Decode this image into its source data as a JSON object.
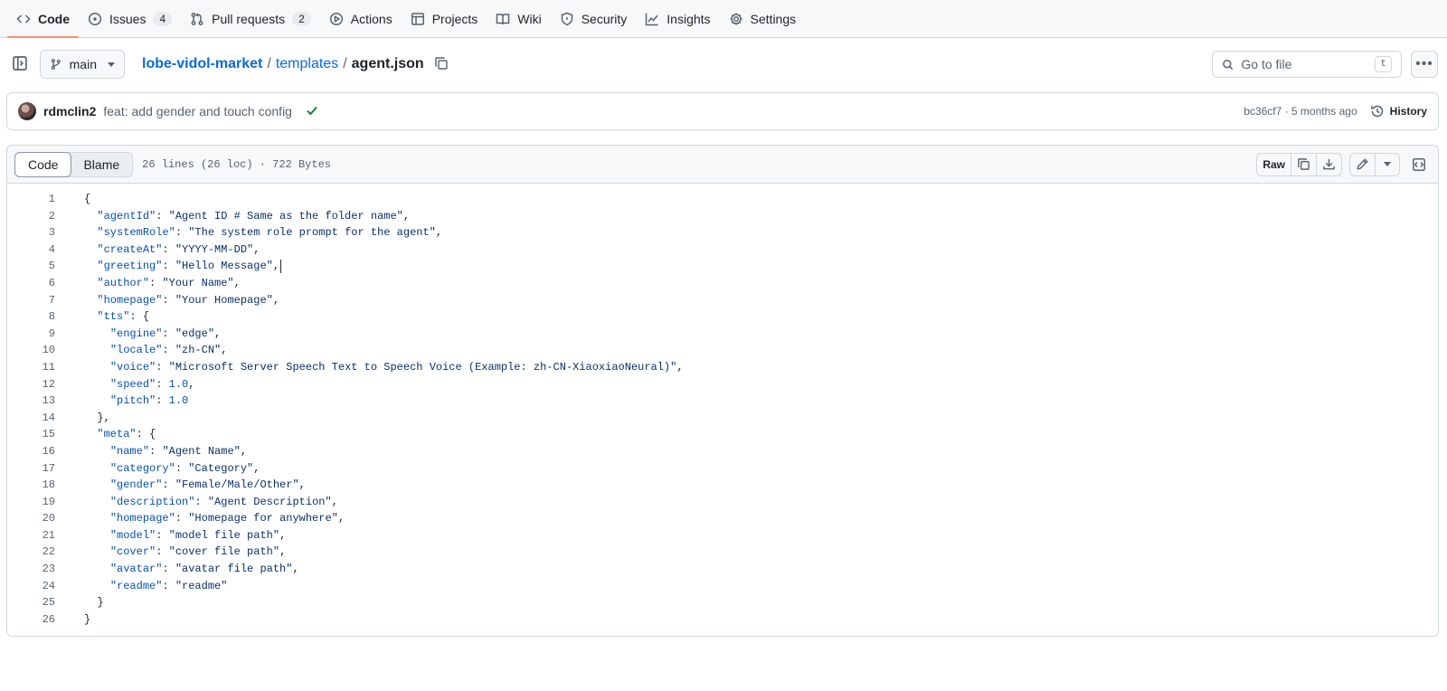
{
  "nav": {
    "tabs": [
      {
        "label": "Code",
        "icon": "code-icon",
        "active": true
      },
      {
        "label": "Issues",
        "icon": "issue-icon",
        "count": "4"
      },
      {
        "label": "Pull requests",
        "icon": "pull-request-icon",
        "count": "2"
      },
      {
        "label": "Actions",
        "icon": "play-icon"
      },
      {
        "label": "Projects",
        "icon": "table-icon"
      },
      {
        "label": "Wiki",
        "icon": "book-icon"
      },
      {
        "label": "Security",
        "icon": "shield-icon"
      },
      {
        "label": "Insights",
        "icon": "graph-icon"
      },
      {
        "label": "Settings",
        "icon": "gear-icon"
      }
    ]
  },
  "branch": {
    "name": "main"
  },
  "breadcrumb": {
    "repo": "lobe-vidol-market",
    "sep": "/",
    "folder": "templates",
    "file": "agent.json"
  },
  "goto": {
    "placeholder": "Go to file",
    "shortcut": "t"
  },
  "commit": {
    "author": "rdmclin2",
    "message": "feat: add gender and touch config",
    "meta": "bc36cf7 · 5 months ago",
    "history_label": "History"
  },
  "file": {
    "view_code": "Code",
    "view_blame": "Blame",
    "info": "26 lines (26 loc) · 722 Bytes",
    "raw_label": "Raw",
    "lines": [
      "{",
      "  \"agentId\": \"Agent ID # Same as the folder name\",",
      "  \"systemRole\": \"The system role prompt for the agent\",",
      "  \"createAt\": \"YYYY-MM-DD\",",
      "  \"greeting\": \"Hello Message\",",
      "  \"author\": \"Your Name\",",
      "  \"homepage\": \"Your Homepage\",",
      "  \"tts\": {",
      "    \"engine\": \"edge\",",
      "    \"locale\": \"zh-CN\",",
      "    \"voice\": \"Microsoft Server Speech Text to Speech Voice (Example: zh-CN-XiaoxiaoNeural)\",",
      "    \"speed\": 1.0,",
      "    \"pitch\": 1.0",
      "  },",
      "  \"meta\": {",
      "    \"name\": \"Agent Name\",",
      "    \"category\": \"Category\",",
      "    \"gender\": \"Female/Male/Other\",",
      "    \"description\": \"Agent Description\",",
      "    \"homepage\": \"Homepage for anywhere\",",
      "    \"model\": \"model file path\",",
      "    \"cover\": \"cover file path\",",
      "    \"avatar\": \"avatar file path\",",
      "    \"readme\": \"readme\"",
      "  }",
      "}"
    ]
  },
  "colors": {
    "accent": "#fd8c73",
    "link": "#0969da",
    "string": "#0a3069",
    "key": "#0550ae",
    "success": "#1a7f37"
  }
}
